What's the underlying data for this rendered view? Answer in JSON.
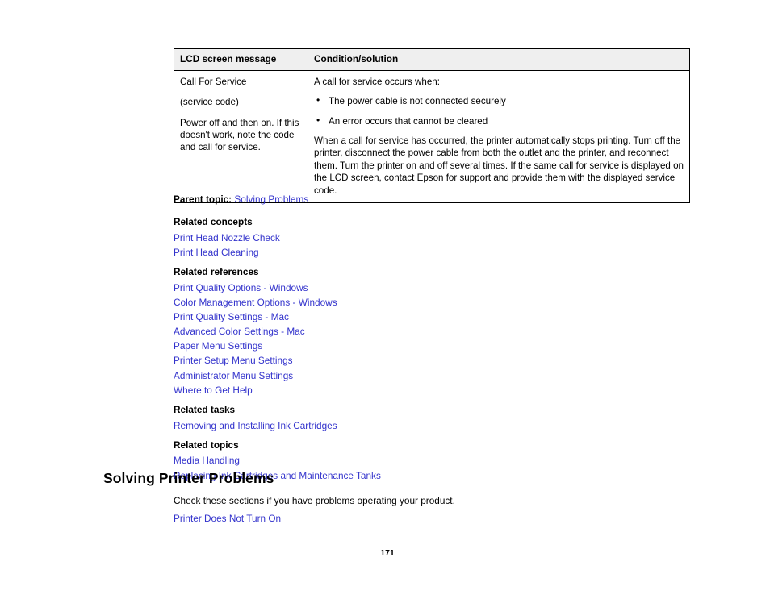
{
  "table": {
    "headers": [
      "LCD screen message",
      "Condition/solution"
    ],
    "rows": [
      {
        "message_lines": [
          "Call For Service",
          "(service code)",
          "Power off and then on. If this doesn't work, note the code and call for service."
        ],
        "solution_intro": "A call for service occurs when:",
        "solution_bullets": [
          "The power cable is not connected securely",
          "An error occurs that cannot be cleared"
        ],
        "solution_body": "When a call for service has occurred, the printer automatically stops printing. Turn off the printer, disconnect the power cable from both the outlet and the printer, and reconnect them. Turn the printer on and off several times. If the same call for service is displayed on the LCD screen, contact Epson for support and provide them with the displayed service code."
      }
    ]
  },
  "parent_topic": {
    "label": "Parent topic:",
    "link": "Solving Problems"
  },
  "related": [
    {
      "heading": "Related concepts",
      "links": [
        "Print Head Nozzle Check",
        "Print Head Cleaning"
      ]
    },
    {
      "heading": "Related references",
      "links": [
        "Print Quality Options - Windows",
        "Color Management Options - Windows",
        "Print Quality Settings - Mac",
        "Advanced Color Settings - Mac",
        "Paper Menu Settings",
        "Printer Setup Menu Settings",
        "Administrator Menu Settings",
        "Where to Get Help"
      ]
    },
    {
      "heading": "Related tasks",
      "links": [
        "Removing and Installing Ink Cartridges"
      ]
    },
    {
      "heading": "Related topics",
      "links": [
        "Media Handling",
        "Replacing Ink Cartridges and Maintenance Tanks"
      ]
    }
  ],
  "section": {
    "title": "Solving Printer Problems",
    "intro": "Check these sections if you have problems operating your product.",
    "links": [
      "Printer Does Not Turn On"
    ]
  },
  "page_number": "171",
  "colors": {
    "link": "#3333cc",
    "table_header_bg": "#efefef",
    "border": "#000000",
    "text": "#000000"
  }
}
